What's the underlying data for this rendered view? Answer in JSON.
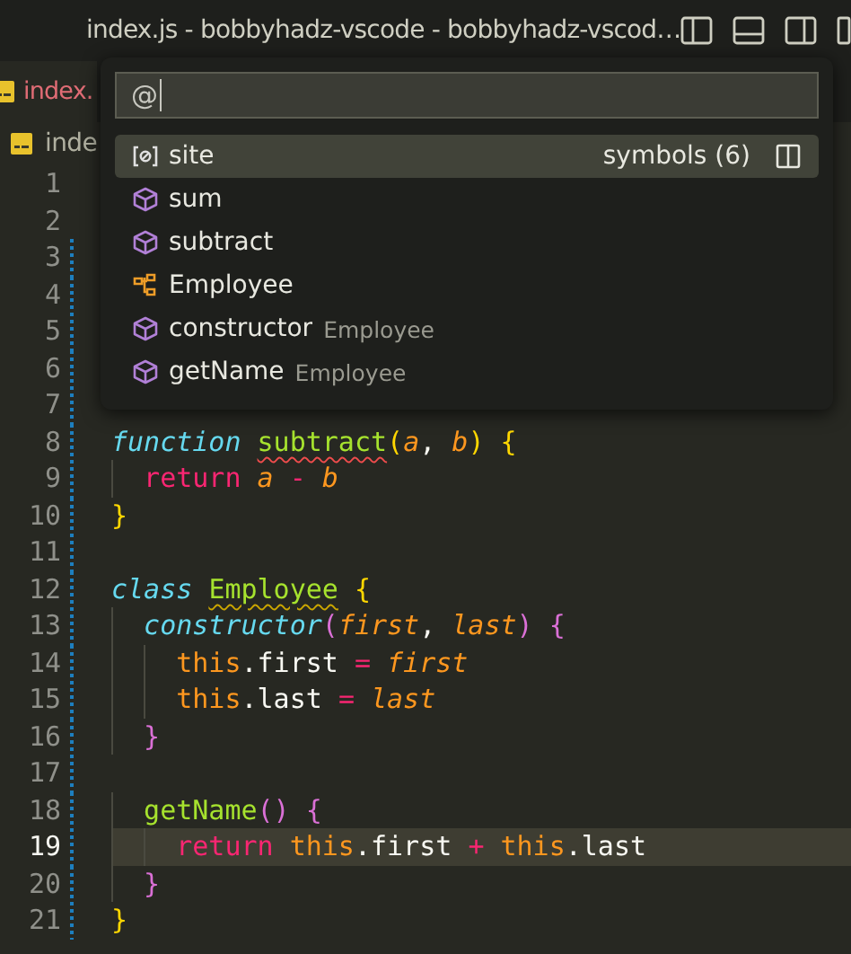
{
  "window": {
    "title": "index.js - bobbyhadz-vscode - bobbyhadz-vscod…"
  },
  "tabs": [
    {
      "label": "index.",
      "selected": true
    }
  ],
  "breadcrumb": {
    "label": "inde"
  },
  "quick_pick": {
    "value": "@",
    "items": [
      {
        "kind": "variable",
        "label": "site",
        "group_label": "symbols (6)",
        "selected": true
      },
      {
        "kind": "method",
        "label": "sum",
        "selected": false
      },
      {
        "kind": "method",
        "label": "subtract",
        "selected": false
      },
      {
        "kind": "class",
        "label": "Employee",
        "selected": false
      },
      {
        "kind": "method",
        "label": "constructor",
        "description": "Employee",
        "selected": false
      },
      {
        "kind": "method",
        "label": "getName",
        "description": "Employee",
        "selected": false
      }
    ]
  },
  "editor": {
    "lines": [
      {
        "number": "1",
        "modified": false,
        "current": false
      },
      {
        "number": "2",
        "modified": false,
        "current": false
      },
      {
        "number": "3",
        "modified": true,
        "current": false
      },
      {
        "number": "4",
        "modified": true,
        "current": false
      },
      {
        "number": "5",
        "modified": true,
        "current": false
      },
      {
        "number": "6",
        "modified": true,
        "current": false
      },
      {
        "number": "7",
        "modified": true,
        "current": false
      },
      {
        "number": "8",
        "modified": true,
        "current": false,
        "tokens": [
          {
            "kind": "keyword",
            "text": "function "
          },
          {
            "kind": "name",
            "text": "subtract",
            "error": true
          },
          {
            "kind": "bracket1",
            "text": "("
          },
          {
            "kind": "param",
            "text": "a"
          },
          {
            "kind": "plain",
            "text": ", "
          },
          {
            "kind": "param",
            "text": "b"
          },
          {
            "kind": "bracket1",
            "text": ") {"
          }
        ]
      },
      {
        "number": "9",
        "modified": true,
        "current": false,
        "tokens": [
          {
            "kind": "control",
            "text": "  return "
          },
          {
            "kind": "param",
            "text": "a "
          },
          {
            "kind": "operator",
            "text": "- "
          },
          {
            "kind": "param",
            "text": "b"
          }
        ]
      },
      {
        "number": "10",
        "modified": true,
        "current": false,
        "tokens": [
          {
            "kind": "bracket1",
            "text": "}"
          }
        ]
      },
      {
        "number": "11",
        "modified": true,
        "current": false
      },
      {
        "number": "12",
        "modified": true,
        "current": false,
        "tokens": [
          {
            "kind": "keyword",
            "text": "class "
          },
          {
            "kind": "name",
            "text": "Employee",
            "warning": true
          },
          {
            "kind": "bracket1",
            "text": " {"
          }
        ]
      },
      {
        "number": "13",
        "modified": true,
        "current": false,
        "tokens": [
          {
            "kind": "keyword",
            "text": "  constructor"
          },
          {
            "kind": "bracket2",
            "text": "("
          },
          {
            "kind": "param",
            "text": "first"
          },
          {
            "kind": "plain",
            "text": ", "
          },
          {
            "kind": "param",
            "text": "last"
          },
          {
            "kind": "bracket2",
            "text": ") {"
          }
        ]
      },
      {
        "number": "14",
        "modified": true,
        "current": false,
        "tokens": [
          {
            "kind": "this",
            "text": "    this"
          },
          {
            "kind": "plain",
            "text": ".first "
          },
          {
            "kind": "operator",
            "text": "= "
          },
          {
            "kind": "param",
            "text": "first"
          }
        ]
      },
      {
        "number": "15",
        "modified": true,
        "current": false,
        "tokens": [
          {
            "kind": "this",
            "text": "    this"
          },
          {
            "kind": "plain",
            "text": ".last "
          },
          {
            "kind": "operator",
            "text": "= "
          },
          {
            "kind": "param",
            "text": "last"
          }
        ]
      },
      {
        "number": "16",
        "modified": true,
        "current": false,
        "tokens": [
          {
            "kind": "bracket2",
            "text": "  }"
          }
        ]
      },
      {
        "number": "17",
        "modified": true,
        "current": false
      },
      {
        "number": "18",
        "modified": true,
        "current": false,
        "tokens": [
          {
            "kind": "name",
            "text": "  getName"
          },
          {
            "kind": "bracket2",
            "text": "() {"
          }
        ]
      },
      {
        "number": "19",
        "modified": true,
        "current": true,
        "tokens": [
          {
            "kind": "control",
            "text": "    return "
          },
          {
            "kind": "this",
            "text": "this"
          },
          {
            "kind": "plain",
            "text": ".first "
          },
          {
            "kind": "operator",
            "text": "+ "
          },
          {
            "kind": "this",
            "text": "this"
          },
          {
            "kind": "plain",
            "text": ".last"
          }
        ]
      },
      {
        "number": "20",
        "modified": true,
        "current": false,
        "tokens": [
          {
            "kind": "bracket2",
            "text": "  }"
          }
        ]
      },
      {
        "number": "21",
        "modified": true,
        "current": false,
        "tokens": [
          {
            "kind": "bracket1",
            "text": "}"
          }
        ]
      }
    ]
  }
}
